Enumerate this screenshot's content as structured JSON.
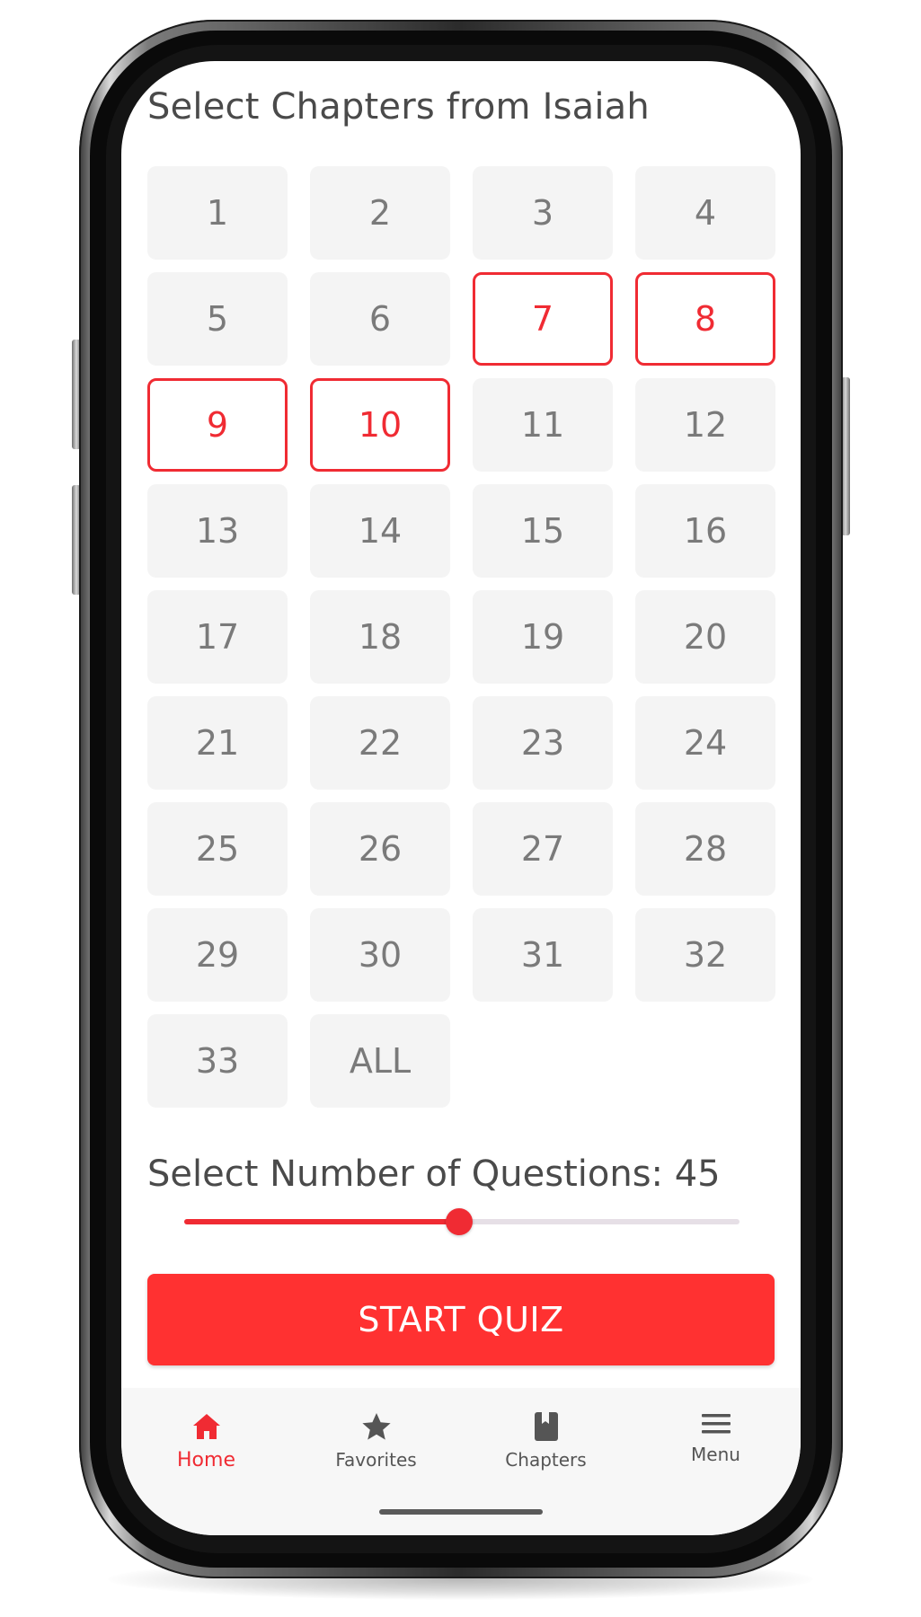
{
  "page": {
    "title": "Select Chapters from Isaiah"
  },
  "chapters": [
    {
      "label": "1",
      "selected": false
    },
    {
      "label": "2",
      "selected": false
    },
    {
      "label": "3",
      "selected": false
    },
    {
      "label": "4",
      "selected": false
    },
    {
      "label": "5",
      "selected": false
    },
    {
      "label": "6",
      "selected": false
    },
    {
      "label": "7",
      "selected": true
    },
    {
      "label": "8",
      "selected": true
    },
    {
      "label": "9",
      "selected": true
    },
    {
      "label": "10",
      "selected": true
    },
    {
      "label": "11",
      "selected": false
    },
    {
      "label": "12",
      "selected": false
    },
    {
      "label": "13",
      "selected": false
    },
    {
      "label": "14",
      "selected": false
    },
    {
      "label": "15",
      "selected": false
    },
    {
      "label": "16",
      "selected": false
    },
    {
      "label": "17",
      "selected": false
    },
    {
      "label": "18",
      "selected": false
    },
    {
      "label": "19",
      "selected": false
    },
    {
      "label": "20",
      "selected": false
    },
    {
      "label": "21",
      "selected": false
    },
    {
      "label": "22",
      "selected": false
    },
    {
      "label": "23",
      "selected": false
    },
    {
      "label": "24",
      "selected": false
    },
    {
      "label": "25",
      "selected": false
    },
    {
      "label": "26",
      "selected": false
    },
    {
      "label": "27",
      "selected": false
    },
    {
      "label": "28",
      "selected": false
    },
    {
      "label": "29",
      "selected": false
    },
    {
      "label": "30",
      "selected": false
    },
    {
      "label": "31",
      "selected": false
    },
    {
      "label": "32",
      "selected": false
    },
    {
      "label": "33",
      "selected": false
    },
    {
      "label": "ALL",
      "selected": false
    }
  ],
  "questions": {
    "label": "Select Number of Questions: 45",
    "slider_fraction": 0.495
  },
  "start_button": {
    "label": "START QUIZ"
  },
  "bottom_nav": {
    "items": [
      {
        "label": "Home",
        "icon": "home-icon",
        "active": true
      },
      {
        "label": "Favorites",
        "icon": "star-icon",
        "active": false
      },
      {
        "label": "Chapters",
        "icon": "book-icon",
        "active": false
      },
      {
        "label": "Menu",
        "icon": "menu-icon",
        "active": false
      }
    ]
  },
  "colors": {
    "accent": "#f02b33",
    "button": "#ff3131",
    "tile_bg": "#f4f4f4",
    "tile_text": "#7a7a7a",
    "nav_bg": "#f7f7f7",
    "nav_text": "#555555"
  }
}
